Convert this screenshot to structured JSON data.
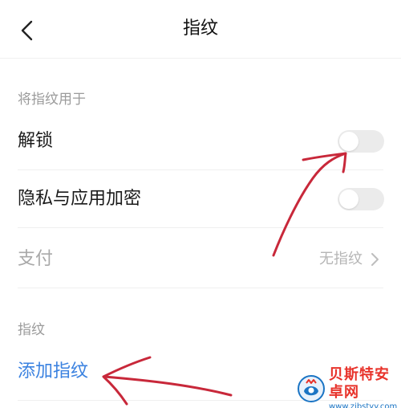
{
  "header": {
    "title": "指纹"
  },
  "sections": [
    {
      "header": "将指纹用于",
      "rows": [
        {
          "label": "解锁",
          "type": "toggle",
          "enabled": false
        },
        {
          "label": "隐私与应用加密",
          "type": "toggle",
          "enabled": false
        },
        {
          "label": "支付",
          "type": "link",
          "value": "无指纹",
          "disabled": true
        }
      ]
    },
    {
      "header": "指纹",
      "rows": [
        {
          "label": "添加指纹",
          "type": "action"
        }
      ]
    }
  ],
  "watermark": {
    "name": "贝斯特安卓网",
    "url": "www.zjbstyy.com"
  },
  "colors": {
    "accent": "#3b82e0",
    "annotation": "#c8283a",
    "watermark_red": "#e8332b",
    "watermark_blue": "#1a74c4"
  },
  "icons": {
    "back": "chevron-left-icon",
    "row_arrow": "chevron-right-icon",
    "brand": "watermark-logo-icon"
  }
}
